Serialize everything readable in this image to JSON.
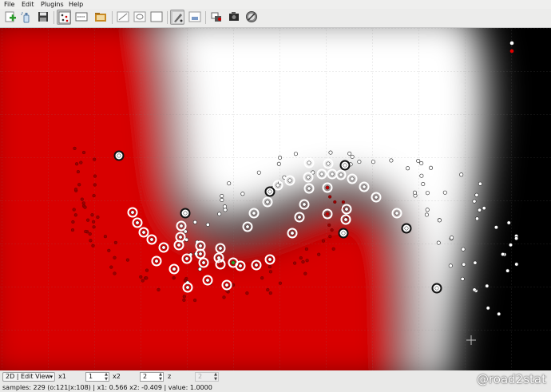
{
  "menu": [
    "File",
    "Edit",
    "Plugins",
    "Help"
  ],
  "toolbar": {
    "buttons": [
      {
        "name": "add-data-icon",
        "active": false
      },
      {
        "name": "spray-icon",
        "active": false
      },
      {
        "name": "save-icon",
        "active": false
      },
      {
        "name": "scatter-view-icon",
        "active": true
      },
      {
        "name": "sample-grid-icon",
        "active": false
      },
      {
        "name": "folder-icon",
        "active": false
      },
      {
        "name": "trajectory-icon",
        "active": false
      },
      {
        "name": "obstacle-icon",
        "active": false
      },
      {
        "name": "blank-canvas-icon",
        "active": false
      },
      {
        "name": "draw-tool-icon",
        "active": true
      },
      {
        "name": "eraser-icon",
        "active": false
      },
      {
        "name": "compare-icon",
        "active": false
      },
      {
        "name": "camera-icon",
        "active": false
      },
      {
        "name": "target-icon",
        "active": false
      }
    ]
  },
  "canvas": {
    "legend_colors": [
      "#ffffff",
      "#e00000"
    ]
  },
  "controls": {
    "view_mode": "2D | Edit View",
    "x1_label": "x1",
    "x1_value": "1",
    "x2_label": "x2",
    "x2_value": "2",
    "z_label": "z",
    "z_value": "2"
  },
  "status": "samples: 229 (o:121|x:108) | x1: 0.566 x2: -0.409 | value: 1.0000",
  "watermark": "@road2stat",
  "colors": {
    "class_white": "#ffffff",
    "class_red": "#e00000",
    "support_vector_green": "#1faa2a"
  }
}
